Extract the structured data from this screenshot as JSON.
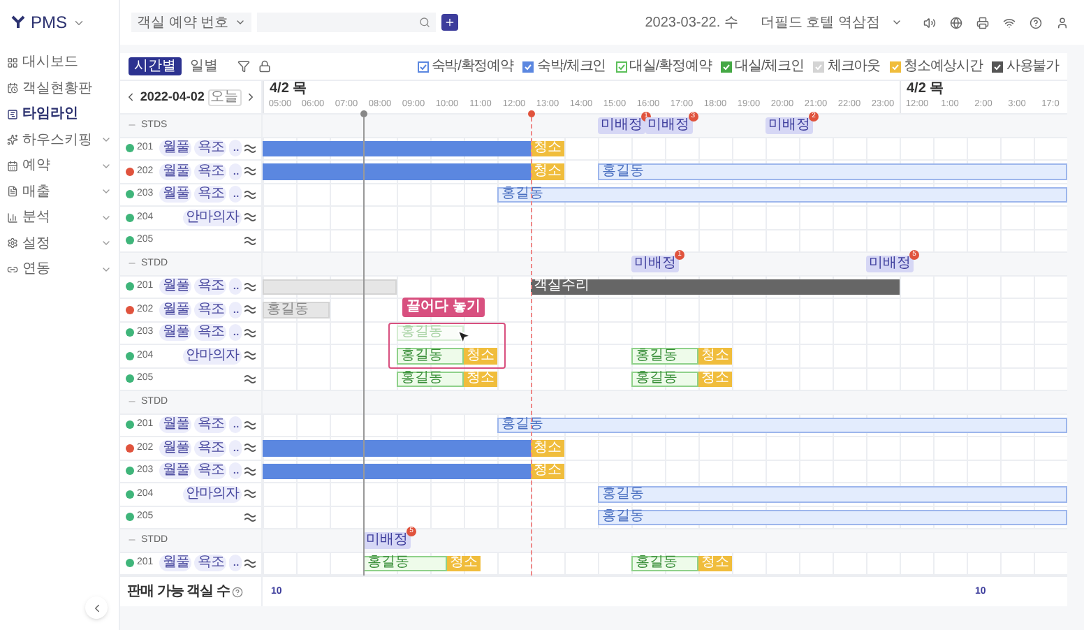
{
  "app": {
    "name": "PMS"
  },
  "sidebar": {
    "items": [
      {
        "label": "대시보드",
        "selected": false,
        "submenu": false
      },
      {
        "label": "객실현황판",
        "selected": false,
        "submenu": false
      },
      {
        "label": "타임라인",
        "selected": true,
        "submenu": false
      },
      {
        "label": "하우스키핑",
        "selected": false,
        "submenu": true
      },
      {
        "label": "예약",
        "selected": false,
        "submenu": true
      },
      {
        "label": "매출",
        "selected": false,
        "submenu": true
      },
      {
        "label": "분석",
        "selected": false,
        "submenu": true
      },
      {
        "label": "설정",
        "selected": false,
        "submenu": true
      },
      {
        "label": "연동",
        "selected": false,
        "submenu": true
      }
    ]
  },
  "topbar": {
    "search_type": "객실 예약 번호",
    "date": "2023-03-22. 수",
    "hotel": "더필드 호텔 역삼점"
  },
  "view_tabs": [
    {
      "label": "시간별",
      "selected": true
    },
    {
      "label": "일별",
      "selected": false
    }
  ],
  "legend": [
    {
      "label": "숙박/확정예약",
      "kind": "outline",
      "color": "#5b87e0"
    },
    {
      "label": "숙박/체크인",
      "kind": "filled",
      "color": "#5b87e0"
    },
    {
      "label": "대실/확정예약",
      "kind": "outline",
      "color": "#5cbf5a"
    },
    {
      "label": "대실/체크인",
      "kind": "filled",
      "color": "#45a845"
    },
    {
      "label": "체크아웃",
      "kind": "filled",
      "color": "#d4d4d4"
    },
    {
      "label": "청소예상시간",
      "kind": "filled",
      "color": "#f0bd3c"
    },
    {
      "label": "사용불가",
      "kind": "filled",
      "color": "#555555"
    }
  ],
  "date_nav": {
    "date": "2022-04-02",
    "today": "오늘"
  },
  "hours": [
    {
      "label": "05:00",
      "date": "4/2 목"
    },
    {
      "label": "06:00"
    },
    {
      "label": "07:00"
    },
    {
      "label": "08:00"
    },
    {
      "label": "09:00"
    },
    {
      "label": "10:00"
    },
    {
      "label": "11:00"
    },
    {
      "label": "12:00"
    },
    {
      "label": "13:00"
    },
    {
      "label": "14:00"
    },
    {
      "label": "15:00"
    },
    {
      "label": "16:00"
    },
    {
      "label": "17:00"
    },
    {
      "label": "18:00"
    },
    {
      "label": "19:00"
    },
    {
      "label": "20:00"
    },
    {
      "label": "21:00"
    },
    {
      "label": "22:00"
    },
    {
      "label": "23:00"
    },
    {
      "label": "12:00",
      "date": "4/2 목"
    },
    {
      "label": "1:00"
    },
    {
      "label": "2:00"
    },
    {
      "label": "3:00"
    },
    {
      "label": "17:0"
    }
  ],
  "groups": [
    {
      "name": "STDS",
      "unassigned": [
        {
          "label": "미배정",
          "count": "1"
        },
        {
          "label": "미배정",
          "count": "3"
        },
        {
          "label": "미배정",
          "count": "2"
        }
      ],
      "rooms": [
        {
          "number": "201",
          "color": "#3fb57a",
          "tags": [
            "월풀",
            "욕조",
            ".."
          ],
          "bars": [
            {
              "kind": "stay_checkin"
            },
            {
              "kind": "clean",
              "label": "청소"
            }
          ]
        },
        {
          "number": "202",
          "color": "#e0533d",
          "tags": [
            "월풀",
            "욕조",
            ".."
          ],
          "bars": [
            {
              "kind": "stay_checkin"
            },
            {
              "kind": "clean",
              "label": "청소"
            },
            {
              "kind": "stay_reserved",
              "label": "홍길동"
            }
          ]
        },
        {
          "number": "203",
          "color": "#3fb57a",
          "tags": [
            "월풀",
            "욕조",
            ".."
          ],
          "bars": [
            {
              "kind": "stay_reserved",
              "label": "홍길동"
            }
          ]
        },
        {
          "number": "204",
          "color": "#3fb57a",
          "tags": [
            "안마의자"
          ]
        },
        {
          "number": "205",
          "color": "#3fb57a"
        }
      ]
    },
    {
      "name": "STDD",
      "unassigned": [
        {
          "label": "미배정",
          "count": "1"
        },
        {
          "label": "미배정",
          "count": "5"
        }
      ],
      "rooms": [
        {
          "number": "201",
          "color": "#3fb57a",
          "tags": [
            "월풀",
            "욕조",
            ".."
          ],
          "bars": [
            {
              "kind": "checkout"
            },
            {
              "kind": "unavailable",
              "label": "객실수리"
            }
          ]
        },
        {
          "number": "202",
          "color": "#e0533d",
          "tags": [
            "월풀",
            "욕조",
            ".."
          ],
          "bars": [
            {
              "kind": "checkout",
              "label": "홍길동"
            }
          ]
        },
        {
          "number": "203",
          "color": "#3fb57a",
          "tags": [
            "월풀",
            "욕조",
            ".."
          ],
          "bars": [
            {
              "kind": "dragging",
              "label": "홍길동"
            }
          ],
          "drag_hint": {
            "label": "끌어다 놓기"
          }
        },
        {
          "number": "204",
          "color": "#3fb57a",
          "tags": [
            "안마의자"
          ],
          "bars": [
            {
              "kind": "day_reserved",
              "label": "홍길동"
            },
            {
              "kind": "clean",
              "label": "청소"
            },
            {
              "kind": "day_reserved",
              "label": "홍길동"
            },
            {
              "kind": "clean",
              "label": "청소"
            }
          ]
        },
        {
          "number": "205",
          "color": "#3fb57a",
          "bars": [
            {
              "kind": "day_reserved",
              "label": "홍길동"
            },
            {
              "kind": "clean",
              "label": "청소"
            },
            {
              "kind": "day_reserved",
              "label": "홍길동"
            },
            {
              "kind": "clean",
              "label": "청소"
            }
          ]
        }
      ]
    },
    {
      "name": "STDD",
      "rooms": [
        {
          "number": "201",
          "color": "#3fb57a",
          "tags": [
            "월풀",
            "욕조",
            ".."
          ],
          "bars": [
            {
              "kind": "stay_reserved",
              "label": "홍길동"
            }
          ]
        },
        {
          "number": "202",
          "color": "#e0533d",
          "tags": [
            "월풀",
            "욕조",
            ".."
          ],
          "bars": [
            {
              "kind": "stay_checkin"
            },
            {
              "kind": "clean",
              "label": "청소"
            }
          ]
        },
        {
          "number": "203",
          "color": "#3fb57a",
          "tags": [
            "월풀",
            "욕조",
            ".."
          ],
          "bars": [
            {
              "kind": "stay_checkin"
            },
            {
              "kind": "clean",
              "label": "청소"
            }
          ]
        },
        {
          "number": "204",
          "color": "#3fb57a",
          "tags": [
            "안마의자"
          ],
          "bars": [
            {
              "kind": "stay_reserved",
              "label": "홍길동"
            }
          ]
        },
        {
          "number": "205",
          "color": "#3fb57a",
          "bars": [
            {
              "kind": "stay_reserved",
              "label": "홍길동"
            }
          ]
        }
      ]
    },
    {
      "name": "STDD",
      "unassigned": [
        {
          "label": "미배정",
          "count": "5"
        }
      ],
      "rooms": [
        {
          "number": "201",
          "color": "#3fb57a",
          "tags": [
            "월풀",
            "욕조",
            ".."
          ],
          "bars": [
            {
              "kind": "day_reserved",
              "label": "홍길동"
            },
            {
              "kind": "clean",
              "label": "청소"
            },
            {
              "kind": "day_reserved",
              "label": "홍길동"
            },
            {
              "kind": "clean",
              "label": "청소"
            }
          ]
        }
      ]
    }
  ],
  "footer": {
    "label": "판매 가능 객실 수",
    "counts": [
      "10",
      "10"
    ]
  }
}
